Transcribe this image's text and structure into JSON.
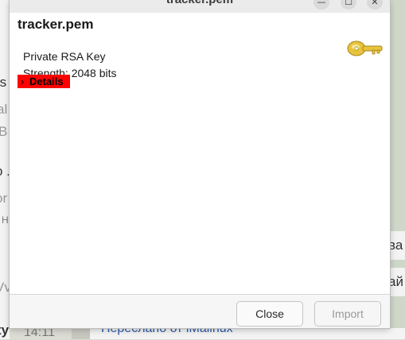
{
  "window": {
    "title": "tracker.pem",
    "minimize_glyph": "—",
    "maximize_glyph": "☐",
    "close_glyph": "✕"
  },
  "key": {
    "name": "tracker.pem",
    "type_line": "Private RSA Key",
    "strength_line": "Strength: 2048 bits",
    "details_label": "Details",
    "details_chevron": "›",
    "icon": "key-icon"
  },
  "buttons": {
    "close_label": "Close",
    "import_label": "Import"
  },
  "background": {
    "left_fragments": [
      "rs",
      "al",
      "B",
      "o .",
      "or",
      "H",
      "Vv",
      "ty"
    ],
    "right_fragments": [
      "ва",
      "ай"
    ],
    "bottom_time": "14:11",
    "bottom_text": "Переслано от lMailnux"
  },
  "colors": {
    "details_highlight": "#ff0000",
    "key_icon": "#e6c23a"
  }
}
